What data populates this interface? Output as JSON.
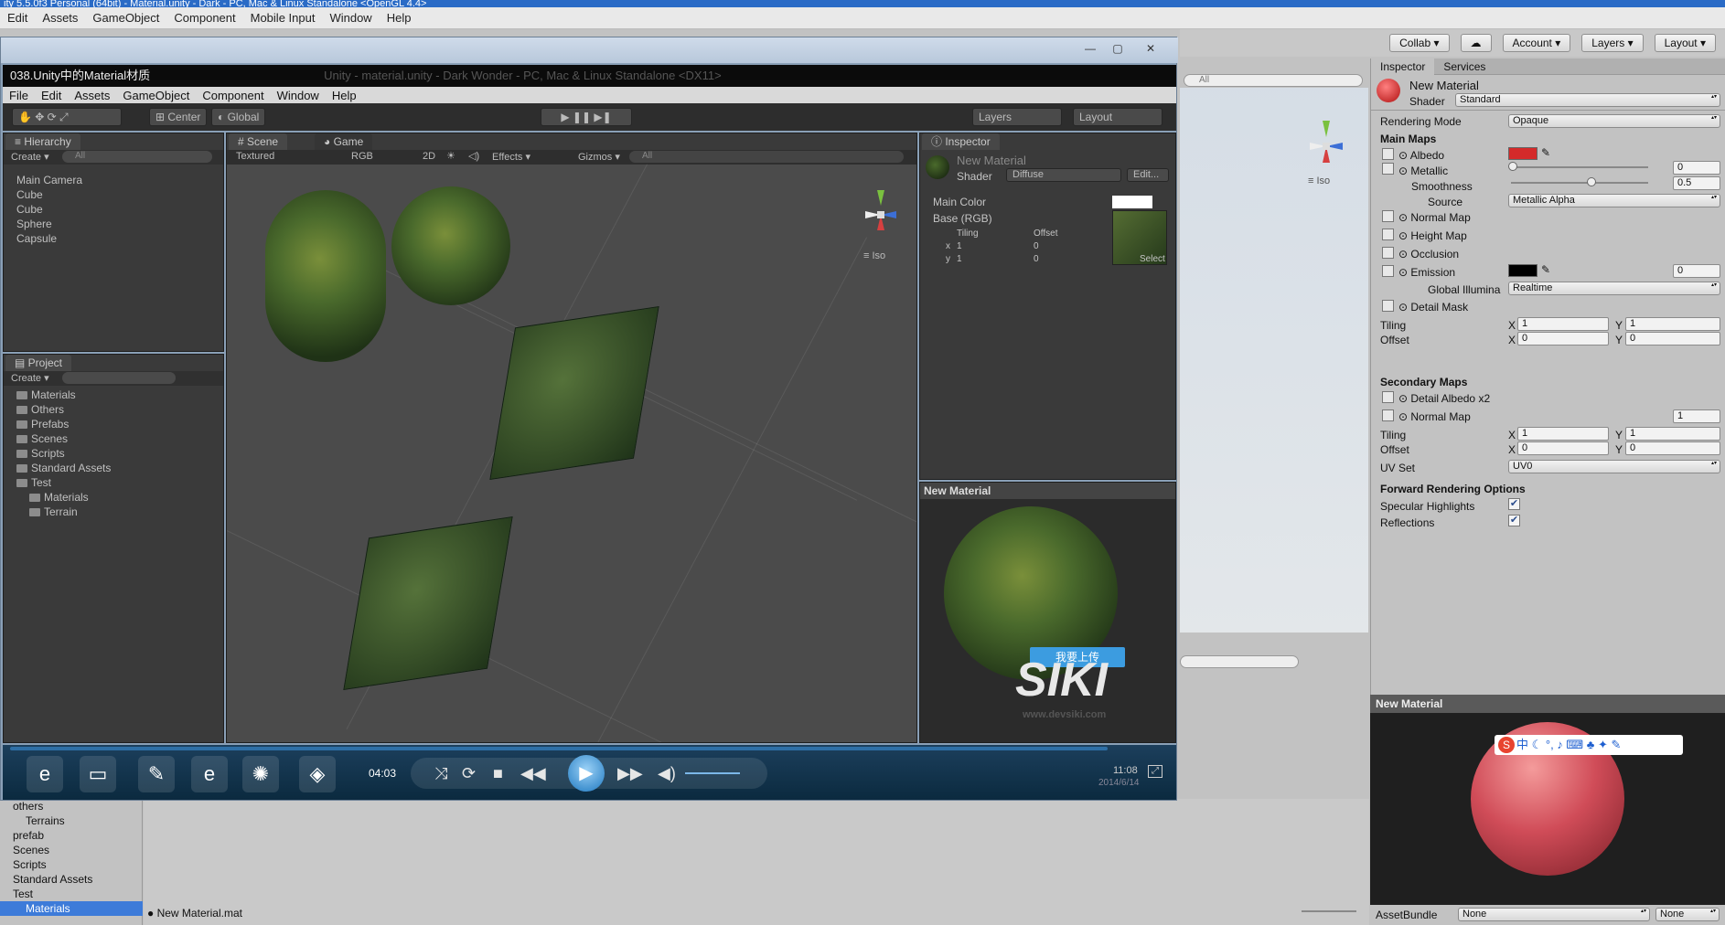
{
  "os_title": "ity 5.5.0f3 Personal (64bit) - Material.unity - Dark - PC, Mac & Linux Standalone <OpenGL 4.4>",
  "outer_menu": [
    "Edit",
    "Assets",
    "GameObject",
    "Component",
    "Mobile Input",
    "Window",
    "Help"
  ],
  "outer_toolbar": {
    "collab": "Collab ▾",
    "account": "Account ▾",
    "layers": "Layers ▾",
    "layout": "Layout ▾"
  },
  "right_inspector": {
    "tabs": [
      "Inspector",
      "Services"
    ],
    "material_name": "New Material",
    "shader_label": "Shader",
    "shader_value": "Standard",
    "rendering_mode_label": "Rendering Mode",
    "rendering_mode_value": "Opaque",
    "main_maps": "Main Maps",
    "albedo": "Albedo",
    "metallic": "Metallic",
    "metallic_value": "0",
    "smoothness": "Smoothness",
    "smoothness_value": "0.5",
    "source": "Source",
    "source_value": "Metallic Alpha",
    "normal_map": "Normal Map",
    "height_map": "Height Map",
    "occlusion": "Occlusion",
    "emission": "Emission",
    "emission_value": "0",
    "global_illum": "Global Illumina",
    "global_illum_value": "Realtime",
    "detail_mask": "Detail Mask",
    "tiling": "Tiling",
    "offset": "Offset",
    "x": "X",
    "y": "Y",
    "tiling_x": "1",
    "tiling_y": "1",
    "offset_x": "0",
    "offset_y": "0",
    "secondary_maps": "Secondary Maps",
    "detail_albedo": "Detail Albedo x2",
    "normal_map2": "Normal Map",
    "normal_map2_value": "1",
    "tiling2_x": "1",
    "tiling2_y": "1",
    "offset2_x": "0",
    "offset2_y": "0",
    "uv_set": "UV Set",
    "uv_set_value": "UV0",
    "forward_options": "Forward Rendering Options",
    "specular": "Specular Highlights",
    "reflections": "Reflections",
    "albedo_color": "#d42a2a",
    "emission_color": "#000000"
  },
  "scene_mini": {
    "search": "All",
    "iso": "≡ Iso"
  },
  "preview_right": {
    "title": "New Material",
    "assetbundle": "AssetBundle",
    "ab_value": "None",
    "ab_variant": "None",
    "ime": "中"
  },
  "bottom_project": {
    "items": [
      "others",
      "Terrains",
      "prefab",
      "Scenes",
      "Scripts",
      "Standard Assets",
      "Test",
      "Materials"
    ],
    "file": "New Material.mat"
  },
  "video": {
    "window_title": "038.Unity中的Material材质",
    "inner_title": "Unity - material.unity - Dark Wonder - PC, Mac & Linux Standalone <DX11>",
    "menu": [
      "File",
      "Edit",
      "Assets",
      "GameObject",
      "Component",
      "Window",
      "Help"
    ],
    "toolbar": {
      "center": "Center",
      "global": "Global",
      "layers": "Layers",
      "layout": "Layout"
    },
    "hierarchy": {
      "tab": "Hierarchy",
      "create": "Create ▾",
      "search": "All",
      "items": [
        "Main Camera",
        "Cube",
        "Cube",
        "Sphere",
        "Capsule"
      ]
    },
    "scene": {
      "tab": "Scene",
      "game_tab": "Game",
      "textured": "Textured",
      "rgb": "RGB",
      "twod": "2D",
      "effects": "Effects ▾",
      "gizmos": "Gizmos ▾",
      "search": "All",
      "iso": "≡ Iso"
    },
    "inspector": {
      "tab": "Inspector",
      "material": "New Material",
      "shader_label": "Shader",
      "shader": "Diffuse",
      "edit": "Edit...",
      "main_color": "Main Color",
      "base": "Base (RGB)",
      "tiling": "Tiling",
      "offset": "Offset",
      "x": "x",
      "y": "y",
      "tx": "1",
      "ty": "1",
      "ox": "0",
      "oy": "0",
      "select": "Select"
    },
    "preview": {
      "title": "New Material",
      "watermark": "SIKI",
      "site": "www.devsiki.com",
      "banner": "我要上传"
    },
    "project": {
      "tab": "Project",
      "create": "Create ▾",
      "folders": [
        "Materials",
        "Others",
        "Prefabs",
        "Scenes",
        "Scripts",
        "Standard Assets",
        "Test"
      ],
      "sub": [
        "Materials",
        "Terrain"
      ]
    },
    "player": {
      "time": "04:03",
      "clock": "11:08",
      "date": "2014/6/14"
    }
  }
}
